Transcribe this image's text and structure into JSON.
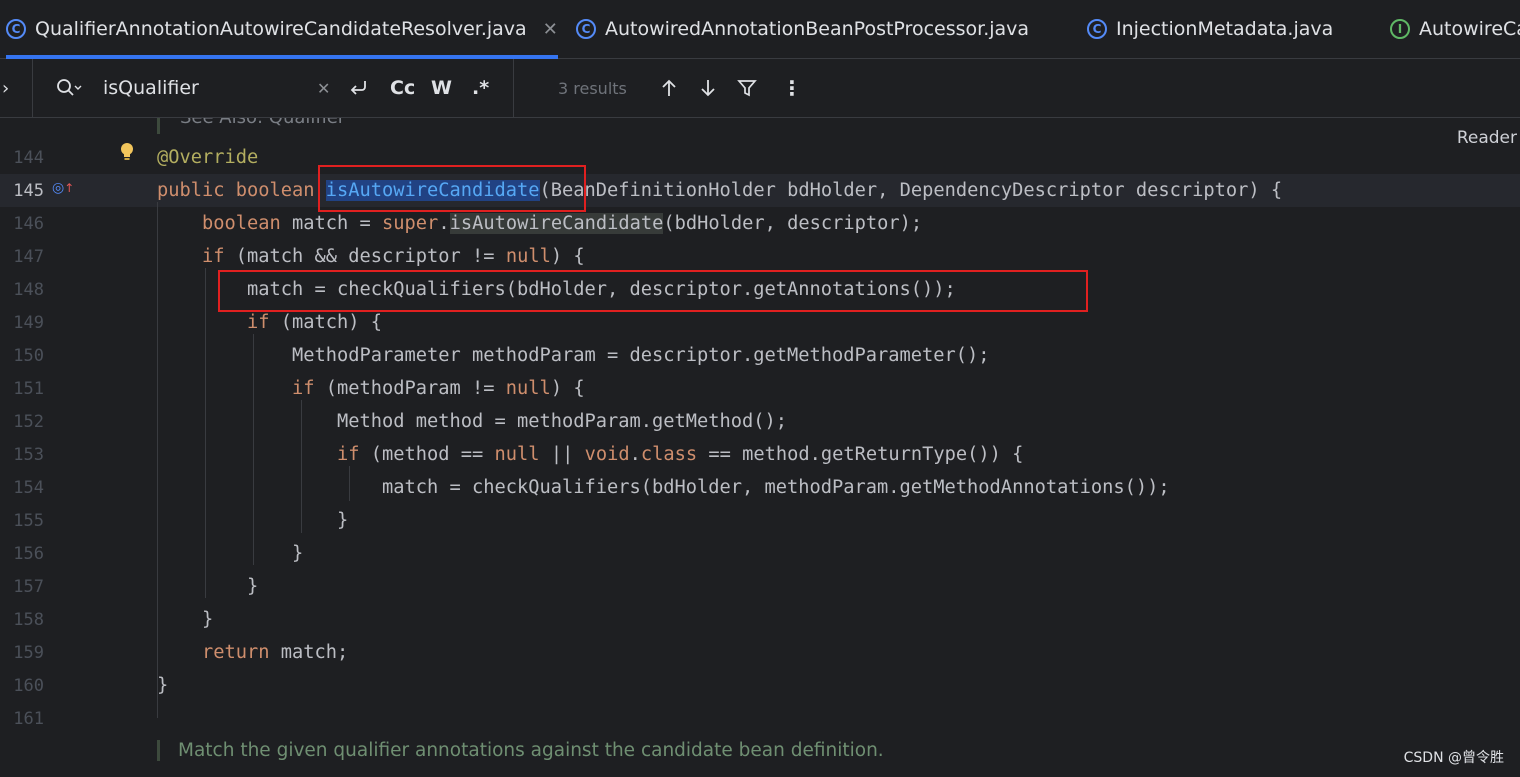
{
  "tabs": [
    {
      "label": "QualifierAnnotationAutowireCandidateResolver.java",
      "icon": "class-icon",
      "active": true
    },
    {
      "label": "AutowiredAnnotationBeanPostProcessor.java",
      "icon": "class-icon"
    },
    {
      "label": "InjectionMetadata.java",
      "icon": "class-icon"
    },
    {
      "label": "AutowireCa",
      "icon": "interface-icon"
    }
  ],
  "tab_close_glyph": "✕",
  "find": {
    "query": "isQualifier",
    "match_case_label": "Cc",
    "words_label": "W",
    "regex_label": ".*",
    "results": "3 results"
  },
  "editor": {
    "partial_top_line": "See Also: Qualifier",
    "reader_mode": "Reader",
    "lines": [
      {
        "n": "144"
      },
      {
        "n": "145"
      },
      {
        "n": "146"
      },
      {
        "n": "147"
      },
      {
        "n": "148"
      },
      {
        "n": "149"
      },
      {
        "n": "150"
      },
      {
        "n": "151"
      },
      {
        "n": "152"
      },
      {
        "n": "153"
      },
      {
        "n": "154"
      },
      {
        "n": "155"
      },
      {
        "n": "156"
      },
      {
        "n": "157"
      },
      {
        "n": "158"
      },
      {
        "n": "159"
      },
      {
        "n": "160"
      },
      {
        "n": "161"
      }
    ],
    "doc_comment": "Match the given qualifier annotations against the candidate bean definition."
  },
  "watermark": "CSDN @曾令胜",
  "colors": {
    "accent": "#3574f0",
    "highlight_box": "#e02020"
  }
}
